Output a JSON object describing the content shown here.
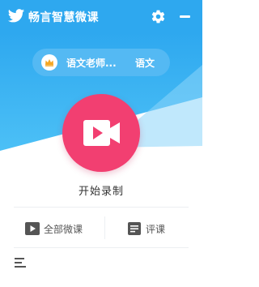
{
  "app": {
    "title": "畅言智慧微课",
    "colors": {
      "accent": "#2ea8ef",
      "record": "#f23f71",
      "text": "#333333"
    }
  },
  "titlebar": {
    "logo_icon": "bird-icon",
    "settings_icon": "gear-icon",
    "minimize_icon": "minimize-icon"
  },
  "subject_selector": {
    "badge_icon": "crown-icon",
    "teacher": "语文老师...",
    "subject": "语文"
  },
  "record": {
    "icon": "video-camera-icon",
    "label": "开始录制"
  },
  "bottom_nav": {
    "all_lessons": {
      "icon": "play-box-icon",
      "label": "全部微课"
    },
    "review": {
      "icon": "document-icon",
      "label": "评课"
    }
  },
  "menu": {
    "icon": "menu-icon"
  }
}
